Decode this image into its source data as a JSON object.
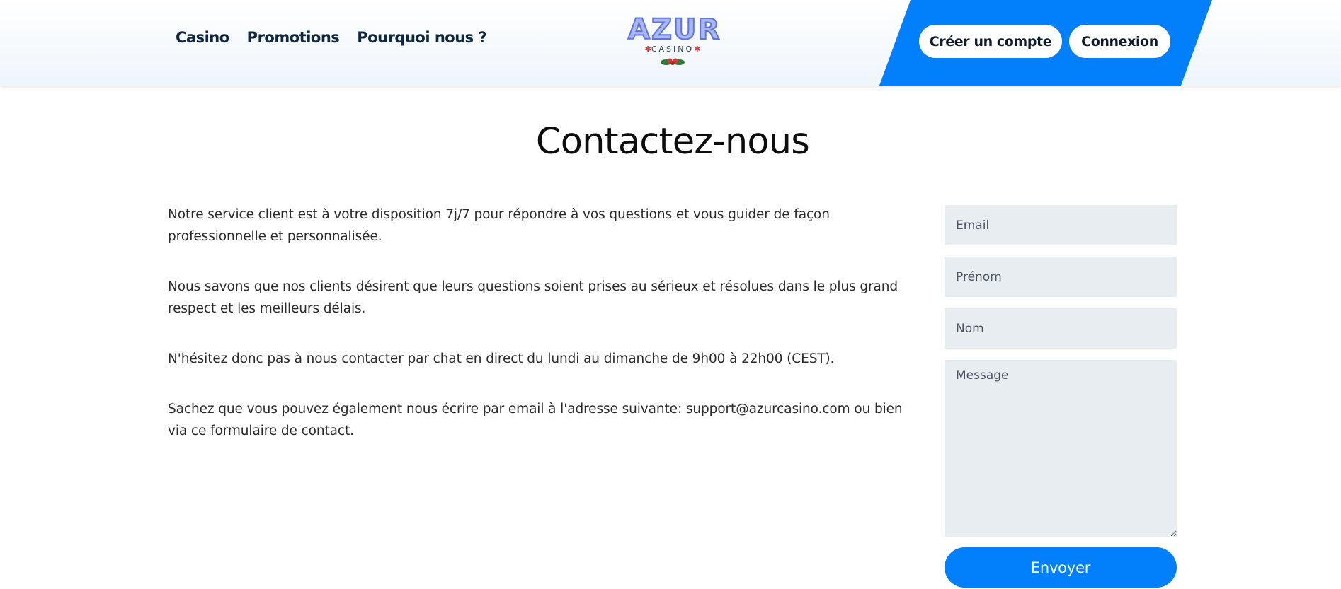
{
  "header": {
    "nav": [
      "Casino",
      "Promotions",
      "Pourquoi nous ?"
    ],
    "logo": {
      "word": "AZUR",
      "sub": "CASINO"
    },
    "register_label": "Créer un compte",
    "login_label": "Connexion"
  },
  "main": {
    "title": "Contactez-nous",
    "paragraphs": [
      "Notre service client est à votre disposition 7j/7 pour répondre à vos questions et vous guider de façon professionnelle et personnalisée.",
      "Nous savons que nos clients désirent que leurs questions soient prises au sérieux et résolues dans le plus grand respect et les meilleurs délais.",
      "N'hésitez donc pas à nous contacter par chat en direct du lundi au dimanche de 9h00 à 22h00 (CEST).",
      "Sachez que vous pouvez également nous écrire par email à l'adresse suivante: support@azurcasino.com ou bien via ce formulaire de contact."
    ]
  },
  "form": {
    "email_placeholder": "Email",
    "firstname_placeholder": "Prénom",
    "lastname_placeholder": "Nom",
    "message_placeholder": "Message",
    "submit_label": "Envoyer"
  },
  "colors": {
    "brand_blue": "#0280fb",
    "field_bg": "#e8edf1",
    "logo_blue": "#5d75e5"
  }
}
